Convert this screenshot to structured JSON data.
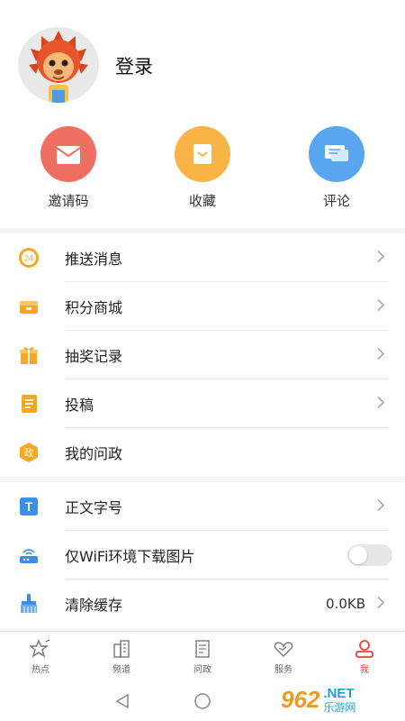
{
  "profile": {
    "login_label": "登录"
  },
  "quick_actions": [
    {
      "label": "邀请码",
      "icon": "envelope-icon",
      "color": "#f06f63"
    },
    {
      "label": "收藏",
      "icon": "bookmark-icon",
      "color": "#f9b448"
    },
    {
      "label": "评论",
      "icon": "chat-bubble-icon",
      "color": "#5aa5ef"
    }
  ],
  "menu_group_1": [
    {
      "label": "推送消息",
      "icon": "push-24-icon",
      "badge": "24"
    },
    {
      "label": "积分商城",
      "icon": "store-icon"
    },
    {
      "label": "抽奖记录",
      "icon": "gift-icon"
    },
    {
      "label": "投稿",
      "icon": "document-icon"
    },
    {
      "label": "我的问政",
      "icon": "gov-hexagon-icon",
      "badge": "政"
    }
  ],
  "menu_group_2": [
    {
      "label": "正文字号",
      "icon": "font-size-icon",
      "glyph": "T"
    },
    {
      "label": "仅WiFi环境下载图片",
      "icon": "wifi-router-icon",
      "toggle": false
    },
    {
      "label": "清除缓存",
      "icon": "broom-icon",
      "value": "0.0KB"
    }
  ],
  "tabbar": [
    {
      "label": "热点",
      "icon": "star-burst-icon",
      "active": false
    },
    {
      "label": "频道",
      "icon": "buildings-icon",
      "active": false
    },
    {
      "label": "问政",
      "icon": "document-stack-icon",
      "active": false
    },
    {
      "label": "服务",
      "icon": "handshake-heart-icon",
      "active": false
    },
    {
      "label": "我",
      "icon": "person-icon",
      "active": true
    }
  ],
  "watermark": {
    "logo": "962",
    "domain": ".NET",
    "name": "乐游网"
  },
  "colors": {
    "accent_red": "#e8413c",
    "orange": "#f9b448",
    "blue": "#3d8ee8"
  }
}
